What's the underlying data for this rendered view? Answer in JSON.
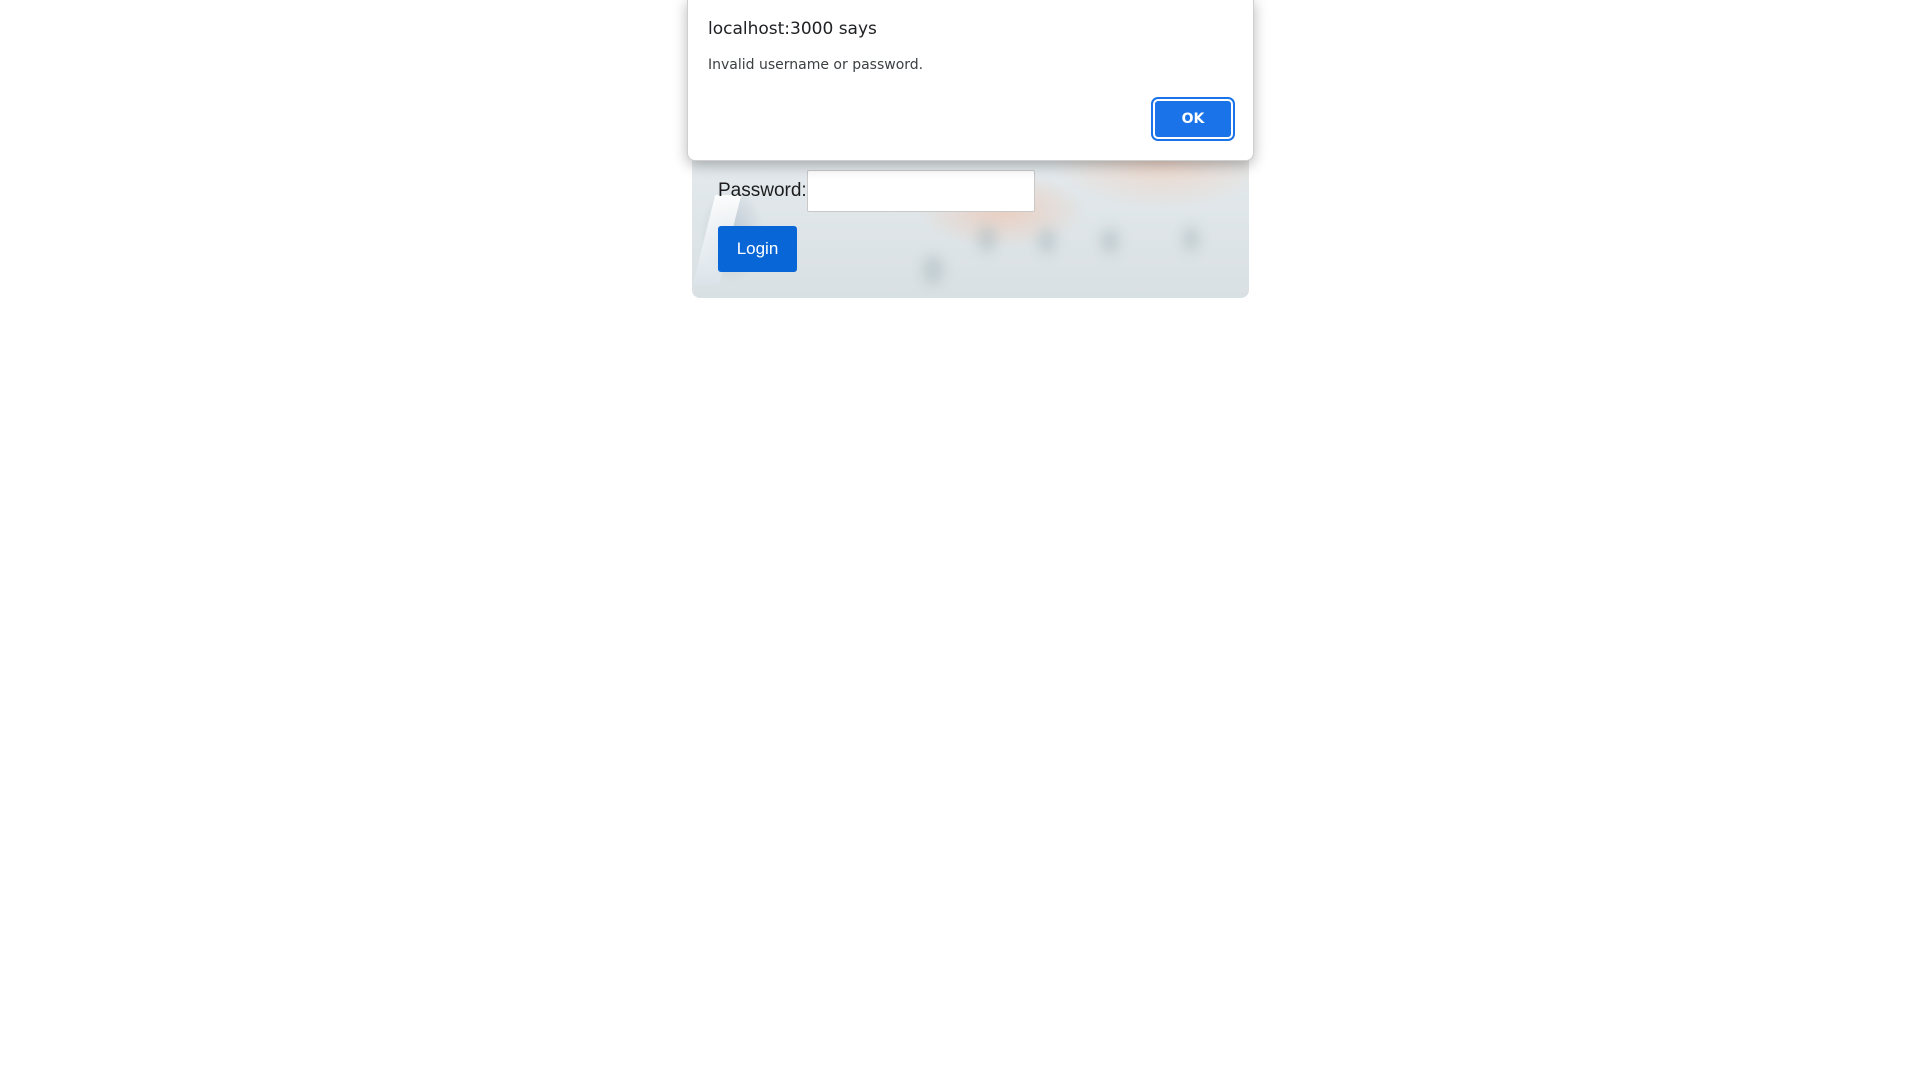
{
  "login_form": {
    "password_label": "Password:",
    "password_value": "",
    "login_button_label": "Login"
  },
  "alert": {
    "title": "localhost:3000 says",
    "message": "Invalid username or password.",
    "ok_label": "OK"
  },
  "colors": {
    "login_button": "#0866d6",
    "alert_ok": "#1a73e8"
  }
}
